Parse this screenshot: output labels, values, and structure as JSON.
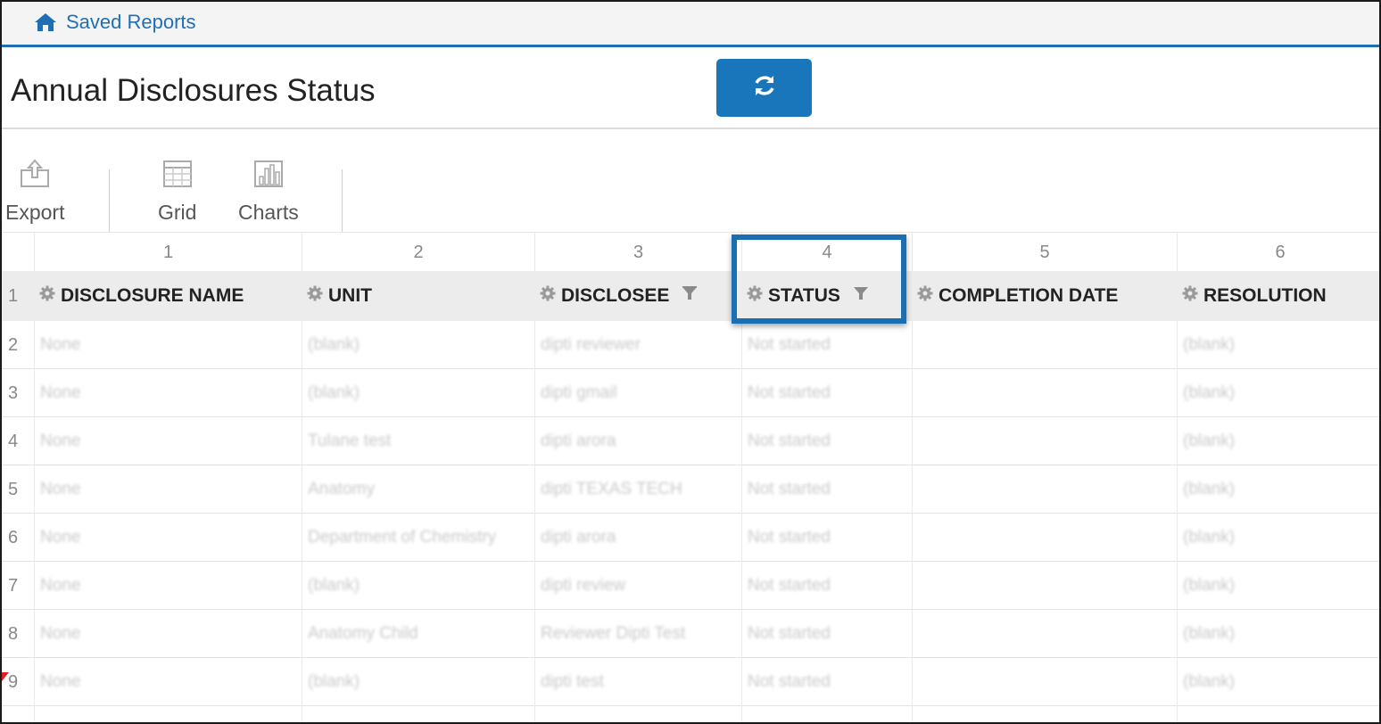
{
  "breadcrumb": {
    "icon": "home-icon",
    "label": "Saved Reports"
  },
  "page_title": "Annual Disclosures Status",
  "refresh_button": {
    "icon": "refresh-icon"
  },
  "toolbar": {
    "export_label": "Export",
    "grid_label": "Grid",
    "charts_label": "Charts"
  },
  "grid": {
    "column_numbers": [
      "1",
      "2",
      "3",
      "4",
      "5",
      "6"
    ],
    "headers": [
      "DISCLOSURE NAME",
      "UNIT",
      "DISCLOSEE",
      "STATUS",
      "COMPLETION DATE",
      "RESOLUTION"
    ],
    "header_row_number": "1",
    "rows": [
      {
        "num": "2",
        "cells": [
          "None",
          "(blank)",
          "dipti reviewer",
          "Not started",
          "",
          "(blank)"
        ]
      },
      {
        "num": "3",
        "cells": [
          "None",
          "(blank)",
          "dipti gmail",
          "Not started",
          "",
          "(blank)"
        ]
      },
      {
        "num": "4",
        "cells": [
          "None",
          "Tulane test",
          "dipti arora",
          "Not started",
          "",
          "(blank)"
        ]
      },
      {
        "num": "5",
        "cells": [
          "None",
          "Anatomy",
          "dipti TEXAS TECH",
          "Not started",
          "",
          "(blank)"
        ]
      },
      {
        "num": "6",
        "cells": [
          "None",
          "Department of Chemistry",
          "dipti arora",
          "Not started",
          "",
          "(blank)"
        ]
      },
      {
        "num": "7",
        "cells": [
          "None",
          "(blank)",
          "dipti review",
          "Not started",
          "",
          "(blank)"
        ]
      },
      {
        "num": "8",
        "cells": [
          "None",
          "Anatomy Child",
          "Reviewer Dipti Test",
          "Not started",
          "",
          "(blank)"
        ]
      },
      {
        "num": "9",
        "cells": [
          "None",
          "(blank)",
          "dipti test",
          "Not started",
          "",
          "(blank)"
        ]
      }
    ]
  },
  "colors": {
    "accent": "#1a76bb",
    "link": "#1f6fb5",
    "header_bg": "#ececec",
    "highlight": "#1a6fb4"
  }
}
